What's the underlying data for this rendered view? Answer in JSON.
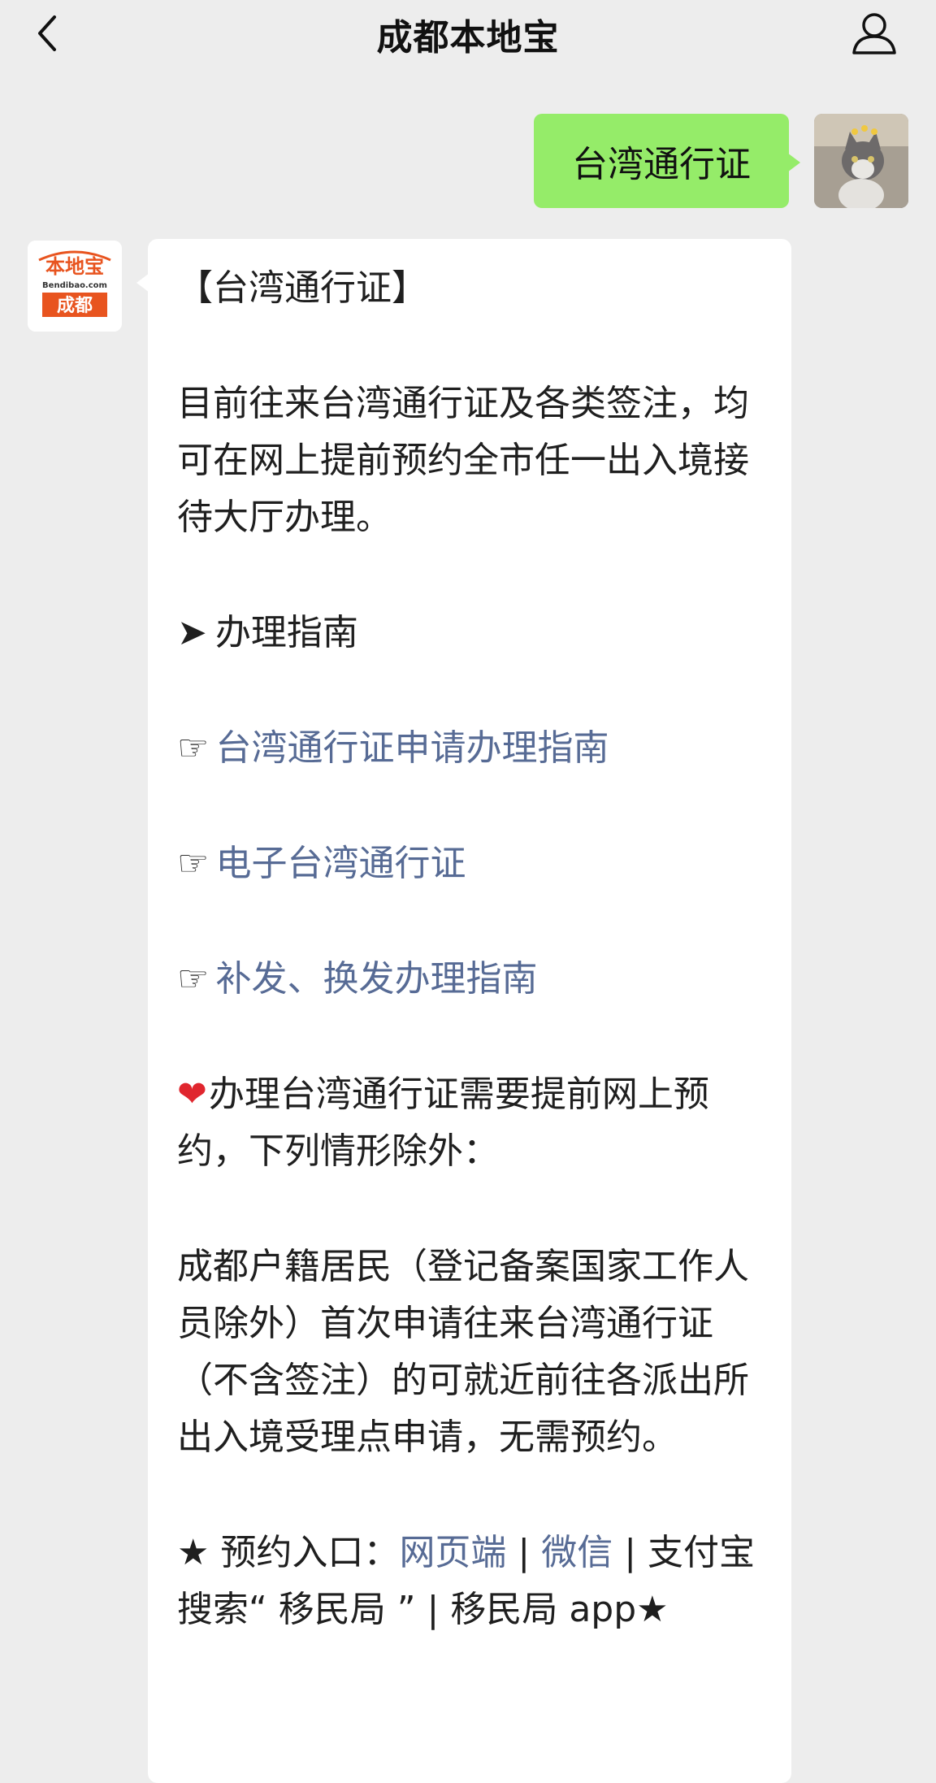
{
  "header": {
    "title": "成都本地宝"
  },
  "sent_message": {
    "text": "台湾通行证"
  },
  "bot_avatar": {
    "logo_top": "本地宝",
    "logo_domain": "Bendibao.com",
    "logo_city": "成都"
  },
  "reply": {
    "heading": "【台湾通行证】",
    "intro": "目前往来台湾通行证及各类签注，均可在网上提前预约全市任一出入境接待大厅办理。",
    "guide_arrow": "➤",
    "guide_title": "办理指南",
    "link_icon": "☞",
    "links": [
      "台湾通行证申请办理指南",
      "电子台湾通行证",
      "补发、换发办理指南"
    ],
    "heart": "❤",
    "notice": "办理台湾通行证需要提前网上预约，下列情形除外：",
    "exception": "成都户籍居民（登记备案国家工作人员除外）首次申请往来台湾通行证（不含签注）的可就近前往各派出所出入境受理点申请，无需预约。",
    "entry_prefix": "★ 预约入口：",
    "entry_web": "网页端",
    "sep": " | ",
    "entry_wechat": "微信",
    "entry_rest": "支付宝搜索“ 移民局 ” | 移民局 app★"
  },
  "colors": {
    "background": "#ededed",
    "sent_bubble": "#95ec69",
    "link": "#576b95",
    "logo_orange": "#e8541f"
  }
}
